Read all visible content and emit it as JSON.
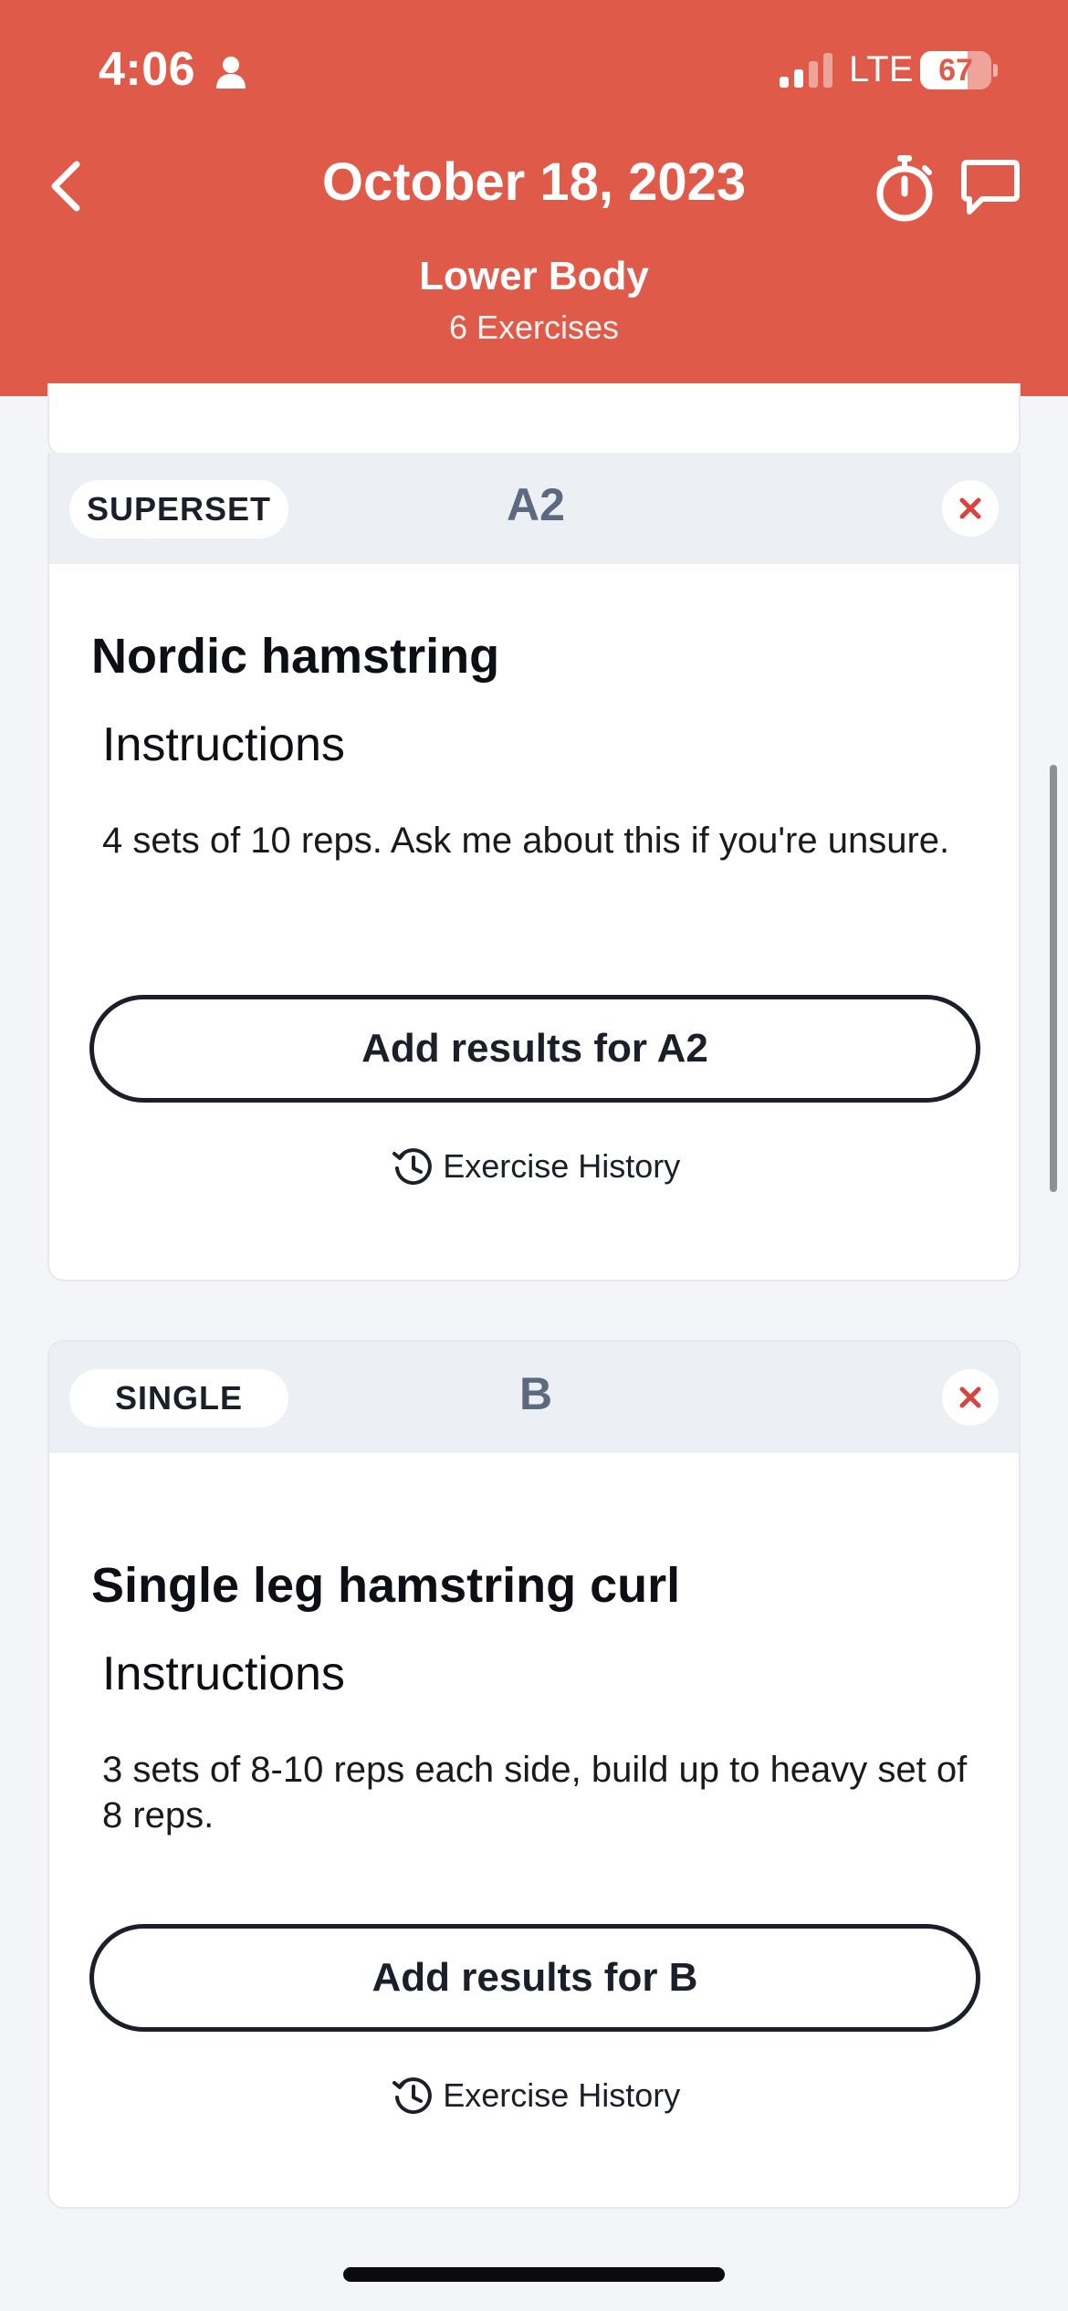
{
  "status_bar": {
    "time": "4:06",
    "network": "LTE",
    "battery_level": "67",
    "battery_fraction": 0.67
  },
  "header": {
    "title": "October 18, 2023",
    "workout_name": "Lower Body",
    "exercise_count": "6 Exercises",
    "icons": [
      "back-icon",
      "stopwatch-icon",
      "chat-icon"
    ]
  },
  "colors": {
    "header_bg": "#e05a4a",
    "card_header_bg": "#eceff4",
    "remove_x": "#d9443f",
    "group_label": "#5c6a80"
  },
  "cards": [
    {
      "type": "SUPERSET",
      "group": "A2",
      "exercise": "Nordic hamstring",
      "instructions_heading": "Instructions",
      "instructions": "4 sets of 10 reps. Ask me about this if you're unsure.",
      "add_results": "Add results for A2",
      "history": "Exercise History"
    },
    {
      "type": "SINGLE",
      "group": "B",
      "exercise": "Single leg hamstring curl",
      "instructions_heading": "Instructions",
      "instructions": "3 sets of 8-10 reps each side, build up to heavy set of 8 reps.",
      "add_results": "Add results for B",
      "history": "Exercise History"
    }
  ]
}
